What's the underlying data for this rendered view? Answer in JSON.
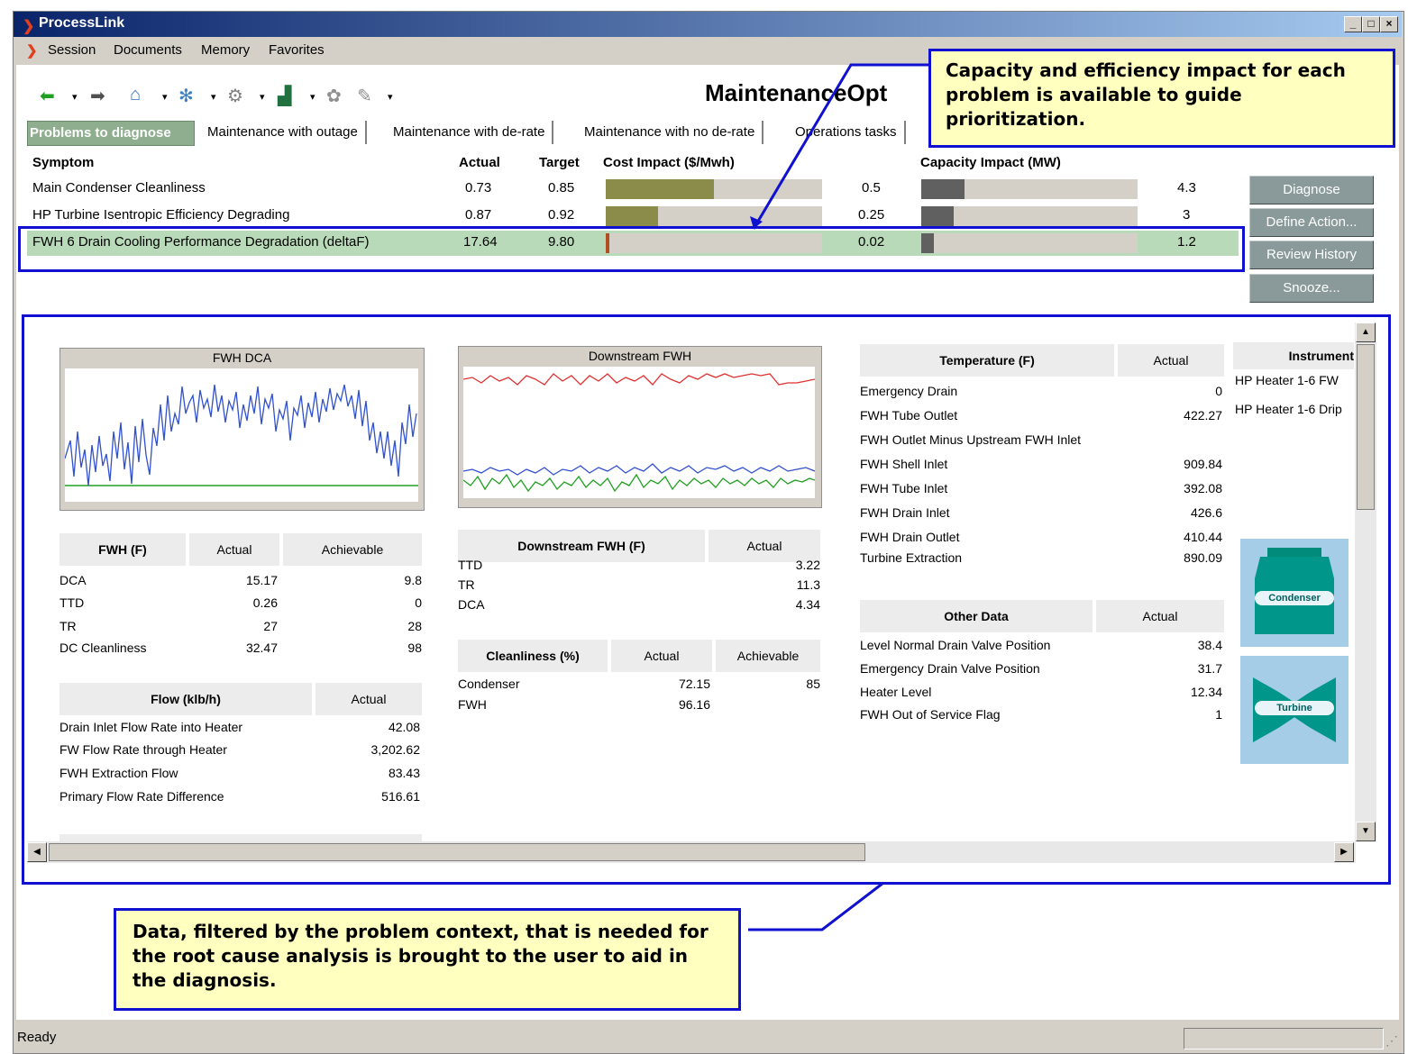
{
  "window": {
    "title": "ProcessLink",
    "min_label": "_",
    "max_label": "□",
    "close_label": "×"
  },
  "menu": [
    "Session",
    "Documents",
    "Memory",
    "Favorites"
  ],
  "app_name": "MaintenanceOpt",
  "tabs": [
    "Problems to diagnose",
    "Maintenance with outage",
    "Maintenance with de-rate",
    "Maintenance with no de-rate",
    "Operations tasks"
  ],
  "problems": {
    "headers": {
      "symptom": "Symptom",
      "actual": "Actual",
      "target": "Target",
      "cost": "Cost Impact ($/Mwh)",
      "capacity": "Capacity Impact (MW)"
    },
    "rows": [
      {
        "symptom": "Main Condenser Cleanliness",
        "actual": "0.73",
        "target": "0.85",
        "cost": "0.5",
        "cost_fill": 0.5,
        "capacity": "4.3",
        "cap_fill": 0.2
      },
      {
        "symptom": "HP Turbine Isentropic Efficiency Degrading",
        "actual": "0.87",
        "target": "0.92",
        "cost": "0.25",
        "cost_fill": 0.24,
        "capacity": "3",
        "cap_fill": 0.15
      },
      {
        "symptom": "FWH 6 Drain Cooling Performance Degradation  (deltaF)",
        "actual": "17.64",
        "target": "9.80",
        "cost": "0.02",
        "cost_fill": 0.015,
        "capacity": "1.2",
        "cap_fill": 0.06
      }
    ],
    "buttons": [
      "Diagnose",
      "Define Action...",
      "Review History",
      "Snooze..."
    ]
  },
  "callouts": {
    "top": "Capacity and efficiency impact for each problem is available to guide prioritization.",
    "bottom": "Data, filtered by the problem context, that is needed for the root cause analysis is brought to the user to aid in the diagnosis."
  },
  "charts": {
    "fwh_dca_title": "FWH DCA",
    "downstream_title": "Downstream FWH"
  },
  "fwh_table": {
    "headers": [
      "FWH (F)",
      "Actual",
      "Achievable"
    ],
    "rows": [
      {
        "label": "DCA",
        "actual": "15.17",
        "ach": "9.8"
      },
      {
        "label": "TTD",
        "actual": "0.26",
        "ach": "0"
      },
      {
        "label": "TR",
        "actual": "27",
        "ach": "28"
      },
      {
        "label": "DC Cleanliness",
        "actual": "32.47",
        "ach": "98"
      }
    ]
  },
  "flow_table": {
    "headers": [
      "Flow (klb/h)",
      "Actual"
    ],
    "rows": [
      {
        "label": "Drain Inlet Flow Rate into Heater",
        "actual": "42.08"
      },
      {
        "label": "FW Flow Rate through Heater",
        "actual": "3,202.62"
      },
      {
        "label": "FWH Extraction Flow",
        "actual": "83.43"
      },
      {
        "label": "Primary Flow Rate Difference",
        "actual": "516.61"
      }
    ]
  },
  "downstream_table": {
    "headers": [
      "Downstream FWH (F)",
      "Actual"
    ],
    "rows": [
      {
        "label": "TTD",
        "actual": "3.22"
      },
      {
        "label": "TR",
        "actual": "11.3"
      },
      {
        "label": "DCA",
        "actual": "4.34"
      }
    ]
  },
  "clean_table": {
    "headers": [
      "Cleanliness (%)",
      "Actual",
      "Achievable"
    ],
    "rows": [
      {
        "label": "Condenser",
        "actual": "72.15",
        "ach": "85"
      },
      {
        "label": "FWH",
        "actual": "96.16",
        "ach": ""
      }
    ]
  },
  "temp_table": {
    "headers": [
      "Temperature (F)",
      "Actual"
    ],
    "rows": [
      {
        "label": "Emergency Drain",
        "actual": "0"
      },
      {
        "label": "FWH Tube Outlet",
        "actual": "422.27"
      },
      {
        "label": "FWH Outlet Minus Upstream FWH Inlet",
        "actual": ""
      },
      {
        "label": "FWH Shell Inlet",
        "actual": "909.84"
      },
      {
        "label": "FWH Tube Inlet",
        "actual": "392.08"
      },
      {
        "label": "FWH Drain Inlet",
        "actual": "426.6"
      },
      {
        "label": "FWH Drain Outlet",
        "actual": "410.44"
      },
      {
        "label": "Turbine Extraction",
        "actual": "890.09"
      }
    ]
  },
  "other_table": {
    "headers": [
      "Other Data",
      "Actual"
    ],
    "rows": [
      {
        "label": "Level Normal Drain Valve Position",
        "actual": "38.4"
      },
      {
        "label": "Emergency Drain Valve Position",
        "actual": "31.7"
      },
      {
        "label": "Heater Level",
        "actual": "12.34"
      },
      {
        "label": "FWH Out of Service Flag",
        "actual": "1"
      }
    ]
  },
  "instrument": {
    "header": "Instrument",
    "items": [
      "HP Heater 1-6 FW",
      "HP Heater 1-6 Drip"
    ]
  },
  "equipment": {
    "condenser": "Condenser",
    "turbine": "Turbine"
  },
  "status": "Ready",
  "colors": {
    "cost_bar": "#8c8c4a",
    "cap_bar": "#606060",
    "callout_border": "#1010d0",
    "selected_row": "#b8dab8"
  }
}
